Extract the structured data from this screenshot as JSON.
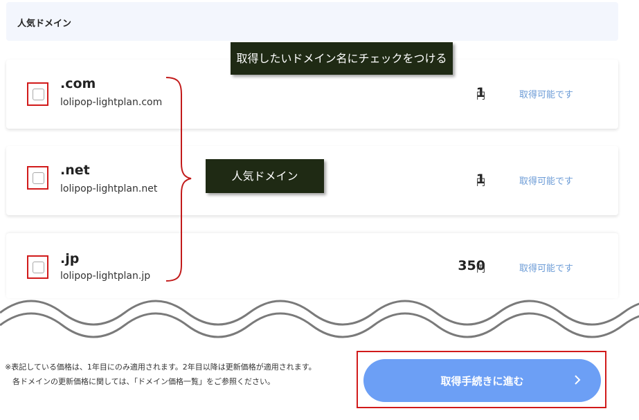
{
  "header": {
    "title": "人気ドメイン"
  },
  "domains": [
    {
      "tld": ".com",
      "name": "lolipop-lightplan.com",
      "price": "1",
      "currency": "円",
      "status": "取得可能です",
      "checked": false
    },
    {
      "tld": ".net",
      "name": "lolipop-lightplan.net",
      "price": "1",
      "currency": "円",
      "status": "取得可能です",
      "checked": false
    },
    {
      "tld": ".jp",
      "name": "lolipop-lightplan.jp",
      "price": "350",
      "currency": "円",
      "status": "取得可能です",
      "checked": false
    }
  ],
  "annotations": {
    "check_instruction": "取得したいドメイン名にチェックをつける",
    "popular_label": "人気ドメイン"
  },
  "footer": {
    "note_line1": "※表記している価格は、1年目にのみ適用されます。2年目以降は更新価格が適用されます。",
    "note_line2": "各ドメインの更新価格に関しては、「ドメイン価格一覧」をご参照ください。",
    "cta_label": "取得手続きに進む"
  },
  "colors": {
    "header_bg": "#f3f6fd",
    "status_text": "#6b9bd6",
    "cta_bg": "#6c9ff5",
    "callout_bg": "#1f2a14",
    "highlight_border": "#d11a1a"
  },
  "icons": {
    "cta_arrow": "chevron-right-icon"
  }
}
